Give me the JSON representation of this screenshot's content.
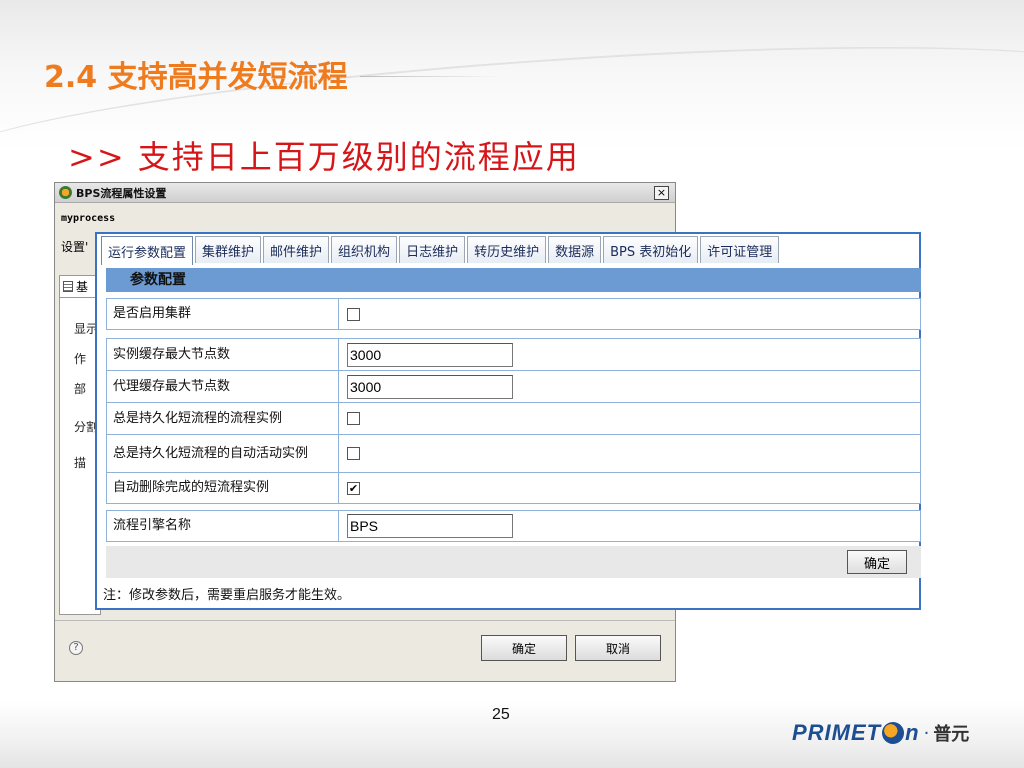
{
  "slide": {
    "title": "2.4 支持高并发短流程",
    "subtitle": ">> 支持日上百万级别的流程应用",
    "page_number": "25",
    "logo": {
      "text_left": "PRIMET",
      "text_right": "n",
      "separator": "·",
      "cn": "普元"
    }
  },
  "back_dialog": {
    "title": "BPS流程属性设置",
    "close": "×",
    "process_name": "myprocess",
    "settings_label": "设置'",
    "tab_label": "基",
    "labels": [
      "显示",
      "作",
      "部",
      "分割",
      "描"
    ],
    "help": "?",
    "ok_label": "确定",
    "cancel_label": "取消"
  },
  "front_panel": {
    "tabs": [
      "运行参数配置",
      "集群维护",
      "邮件维护",
      "组织机构",
      "日志维护",
      "转历史维护",
      "数据源",
      "BPS 表初始化",
      "许可证管理"
    ],
    "section_title": "参数配置",
    "rows": [
      {
        "label": "是否启用集群",
        "type": "checkbox",
        "checked": false
      },
      {
        "label": "实例缓存最大节点数",
        "type": "input",
        "value": "3000"
      },
      {
        "label": "代理缓存最大节点数",
        "type": "input",
        "value": "3000"
      },
      {
        "label": "总是持久化短流程的流程实例",
        "type": "checkbox",
        "checked": false
      },
      {
        "label": "总是持久化短流程的自动活动实例",
        "type": "checkbox",
        "checked": false
      },
      {
        "label": "自动删除完成的短流程实例",
        "type": "checkbox",
        "checked": true
      },
      {
        "label": "流程引擎名称",
        "type": "input",
        "value": "BPS"
      }
    ],
    "checkmark": "✔",
    "confirm_label": "确定",
    "note": "注：修改参数后，需要重启服务才能生效。"
  },
  "colors": {
    "title_orange": "#ef7b1f",
    "subtitle_red": "#d61519",
    "panel_border_blue": "#3a72c4",
    "section_header_blue": "#6b9bd2",
    "logo_blue": "#1d4e91"
  }
}
